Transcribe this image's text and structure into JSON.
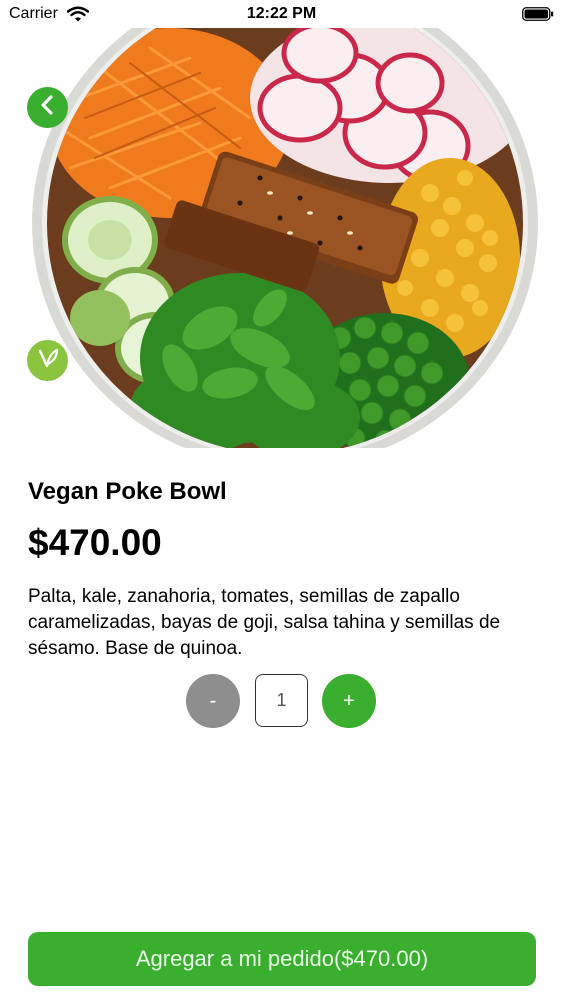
{
  "status_bar": {
    "carrier": "Carrier",
    "time": "12:22 PM",
    "wifi_icon": "wifi-icon",
    "battery_icon": "battery-icon"
  },
  "hero": {
    "back_icon": "chevron-left-icon",
    "badge_icon": "vegan-leaf-icon",
    "accent_color": "#3aae2e",
    "badge_color": "#8bc53f"
  },
  "product": {
    "name": "Vegan Poke Bowl",
    "price": "$470.00",
    "description": "Palta, kale, zanahoria, tomates, semillas de zapallo caramelizadas, bayas de goji,  salsa tahina y semillas de sésamo. Base de quinoa."
  },
  "quantity": {
    "minus_label": "-",
    "value": "1",
    "plus_label": "+"
  },
  "cta": {
    "label": "Agregar a mi pedido($470.00)"
  }
}
